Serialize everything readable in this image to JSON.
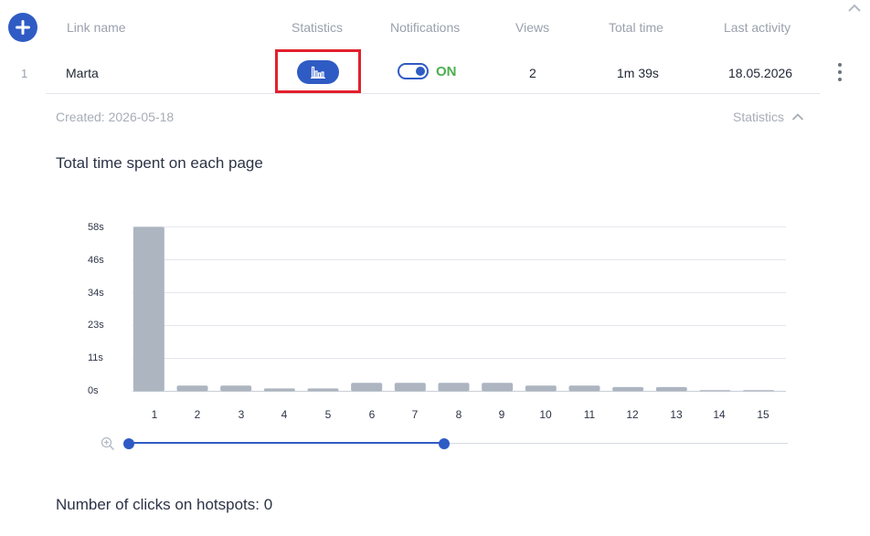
{
  "header": {
    "columns": [
      "Link name",
      "Statistics",
      "Notifications",
      "Views",
      "Total time",
      "Last activity"
    ]
  },
  "row": {
    "index": "1",
    "link_name": "Marta",
    "notifications_state": "ON",
    "views": "2",
    "total_time": "1m 39s",
    "last_activity": "18.05.2026"
  },
  "details": {
    "created": "Created: 2026-05-18",
    "statistics_toggle": "Statistics"
  },
  "chart_data": {
    "type": "bar",
    "title": "Total time spent on each page",
    "categories": [
      "1",
      "2",
      "3",
      "4",
      "5",
      "6",
      "7",
      "8",
      "9",
      "10",
      "11",
      "12",
      "13",
      "14",
      "15"
    ],
    "values": [
      58,
      2,
      2,
      1,
      1,
      3,
      3,
      3,
      3,
      2,
      2,
      1.5,
      1.5,
      0,
      0
    ],
    "y_ticks": [
      "0s",
      "11s",
      "23s",
      "34s",
      "46s",
      "58s"
    ],
    "ylim": [
      0,
      58
    ],
    "grid": true,
    "bar_color": "#adb5c1",
    "zoom_range": [
      1,
      8
    ]
  },
  "hotspots": {
    "title": "Number of clicks on hotspots: 0"
  },
  "colors": {
    "accent": "#2f5bc4",
    "on_green": "#4caf50",
    "highlight_red": "#e3202c"
  }
}
